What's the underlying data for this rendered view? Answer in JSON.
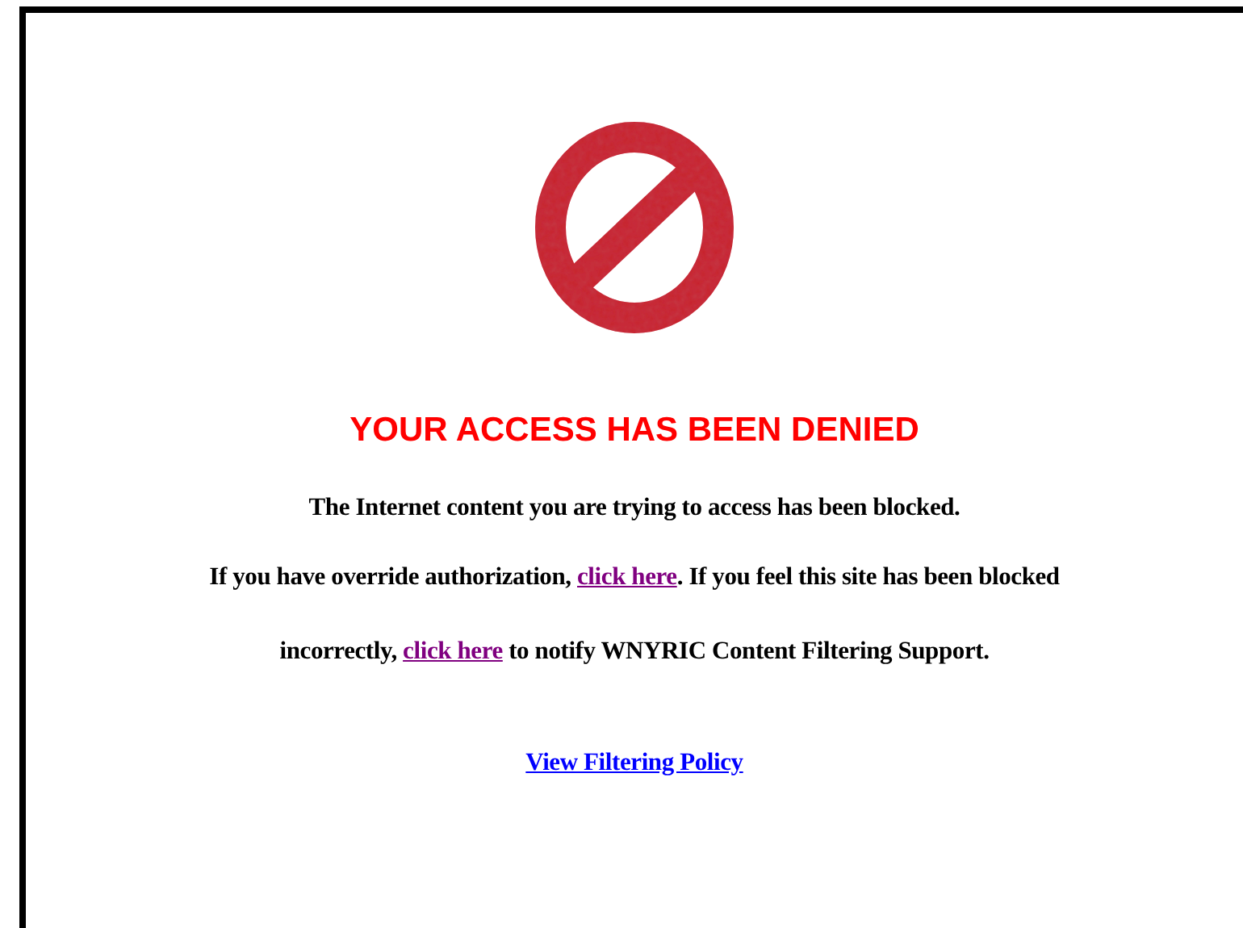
{
  "heading": "YOUR ACCESS HAS BEEN DENIED",
  "message": "The Internet content you are trying to access has been blocked.",
  "override_paragraph": [
    {
      "kind": "text",
      "text": "If you have override authorization, "
    },
    {
      "kind": "link",
      "text": "click here",
      "visited": true
    },
    {
      "kind": "text",
      "text": ". If you feel this site has been blocked incorrectly, "
    },
    {
      "kind": "link",
      "text": "click here",
      "visited": true
    },
    {
      "kind": "text",
      "text": " to notify WNYRIC Content Filtering Support."
    }
  ],
  "policy_link": {
    "text": "View Filtering Policy",
    "visited": false
  }
}
